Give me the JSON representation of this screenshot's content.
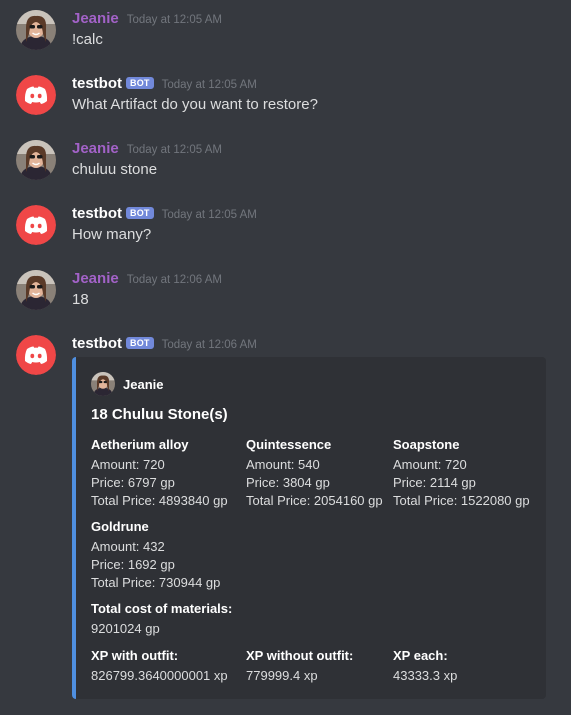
{
  "colors": {
    "background": "#36393f",
    "embed_background": "#2f3136",
    "embed_accent": "#4f8fe0",
    "user_name": "#a362c8",
    "bot_badge": "#7289da",
    "bot_avatar": "#f04747"
  },
  "messages": [
    {
      "author": "Jeanie",
      "timestamp": "Today at 12:05 AM",
      "text": "!calc",
      "avatar": "user-avatar"
    },
    {
      "author": "testbot",
      "badge": "BOT",
      "timestamp": "Today at 12:05 AM",
      "text": "What Artifact do you want to restore?",
      "avatar": "discord-logo-icon"
    },
    {
      "author": "Jeanie",
      "timestamp": "Today at 12:05 AM",
      "text": "chuluu stone",
      "avatar": "user-avatar"
    },
    {
      "author": "testbot",
      "badge": "BOT",
      "timestamp": "Today at 12:05 AM",
      "text": "How many?",
      "avatar": "discord-logo-icon"
    },
    {
      "author": "Jeanie",
      "timestamp": "Today at 12:06 AM",
      "text": "18",
      "avatar": "user-avatar"
    },
    {
      "author": "testbot",
      "badge": "BOT",
      "timestamp": "Today at 12:06 AM",
      "text": "",
      "avatar": "discord-logo-icon"
    }
  ],
  "embed": {
    "author": "Jeanie",
    "title": "18 Chuluu Stone(s)",
    "fields": [
      {
        "name": "Aetherium alloy",
        "lines": [
          "Amount: 720",
          "Price: 6797 gp",
          "Total Price: 4893840 gp"
        ]
      },
      {
        "name": "Quintessence",
        "lines": [
          "Amount: 540",
          "Price: 3804 gp",
          "Total Price: 2054160 gp"
        ]
      },
      {
        "name": "Soapstone",
        "lines": [
          "Amount: 720",
          "Price: 2114 gp",
          "Total Price: 1522080 gp"
        ]
      },
      {
        "name": "Goldrune",
        "lines": [
          "Amount: 432",
          "Price: 1692 gp",
          "Total Price: 730944 gp"
        ]
      },
      {
        "name": "Total cost of materials:",
        "lines": [
          "9201024 gp"
        ]
      },
      {
        "name": "XP with outfit:",
        "lines": [
          "826799.3640000001 xp"
        ]
      },
      {
        "name": "XP without outfit:",
        "lines": [
          "779999.4 xp"
        ]
      },
      {
        "name": "XP each:",
        "lines": [
          "43333.3 xp"
        ]
      }
    ]
  }
}
